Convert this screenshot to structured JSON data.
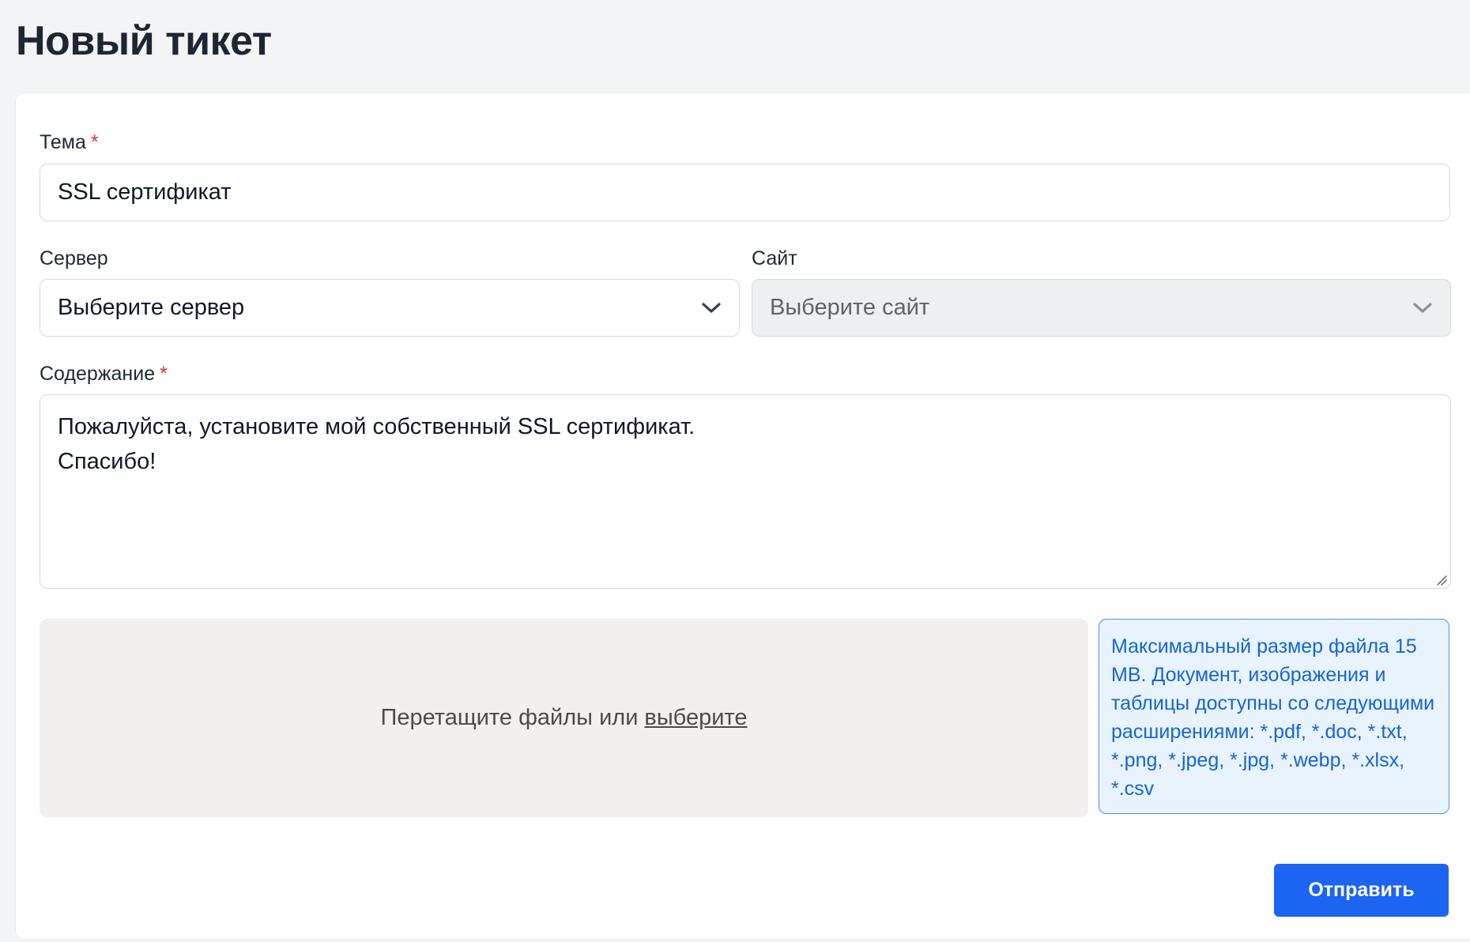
{
  "page": {
    "title": "Новый тикет"
  },
  "form": {
    "subject": {
      "label": "Тема",
      "required_mark": "*",
      "value": "SSL сертификат"
    },
    "server": {
      "label": "Сервер",
      "selected": "Выберите сервер"
    },
    "site": {
      "label": "Сайт",
      "selected": "Выберите сайт",
      "disabled": true
    },
    "content": {
      "label": "Содержание",
      "required_mark": "*",
      "value": "Пожалуйста, установите мой собственный SSL сертификат.\nСпасибо!"
    },
    "upload": {
      "prompt": "Перетащите файлы или",
      "link_label": "выберите",
      "info": "Максимальный размер файла 15 MB. Документ, изображения и таблицы доступны со следующими расширениями: *.pdf, *.doc, *.txt, *.png, *.jpeg, *.jpg, *.webp, *.xlsx, *.csv"
    },
    "submit_label": "Отправить"
  },
  "icons": {
    "select_chevron": "chevron-down-icon",
    "textarea_grip": "resize-grip-icon"
  },
  "colors": {
    "primary": "#1c64f2",
    "required": "#e03131",
    "info_text": "#1565d8",
    "info_bg": "#e8f3fe",
    "info_border": "#4a92e8"
  }
}
